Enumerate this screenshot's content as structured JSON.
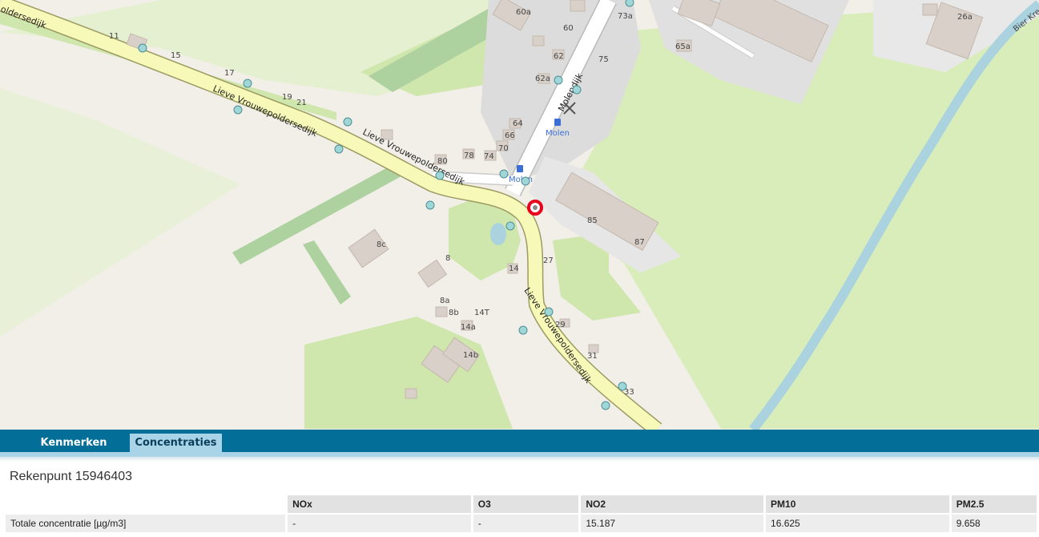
{
  "map": {
    "street_labels": {
      "top_left": "oldersedijk",
      "main_upper": "Lieve Vrouwepoldersedijk",
      "main_middle": "Lieve Vrouwepoldersedijk",
      "main_lower": "Lieve Vrouwepoldersedijk",
      "molendijk": "Molendijk",
      "creek": "Bier Kree"
    },
    "house_numbers": {
      "n11": "11",
      "n15": "15",
      "n17": "17",
      "n19": "19",
      "n21": "21",
      "n60a": "60a",
      "n60": "60",
      "n62": "62",
      "n62a": "62a",
      "n64": "64",
      "n66": "66",
      "n70": "70",
      "n74": "74",
      "n78": "78",
      "n80": "80",
      "n73a": "73a",
      "n75": "75",
      "n65a": "65a",
      "n26a": "26a",
      "n85": "85",
      "n87": "87",
      "n27": "27",
      "n8c": "8c",
      "n8": "8",
      "n8a": "8a",
      "n8b": "8b",
      "n14": "14",
      "n14T": "14T",
      "n14a": "14a",
      "n14b": "14b",
      "n29": "29",
      "n31": "31",
      "n33": "33"
    },
    "poi_labels": {
      "bus_stop_1": "Molen",
      "bus_stop_2": "Molen"
    },
    "colors": {
      "background": "#f2efe9",
      "meadow": "#d9edba",
      "grassland": "#cfe6ac",
      "forest": "#aed1a0",
      "main_road": "#f7f9b8",
      "road_casing": "#9b9b62",
      "water": "#aad3df",
      "building": "#d9d0c9",
      "measurement_point": "#9fd6d8",
      "selected_point": "#e8001c"
    }
  },
  "tabs": [
    {
      "label": "Kenmerken",
      "active": false
    },
    {
      "label": "Concentraties",
      "active": true
    }
  ],
  "panel": {
    "title": "Rekenpunt 15946403",
    "table": {
      "columns": [
        "NOx",
        "O3",
        "NO2",
        "PM10",
        "PM2.5"
      ],
      "rows": [
        {
          "label": "Totale concentratie [µg/m3]",
          "values": [
            "-",
            "-",
            "15.187",
            "16.625",
            "9.658"
          ]
        }
      ]
    }
  }
}
